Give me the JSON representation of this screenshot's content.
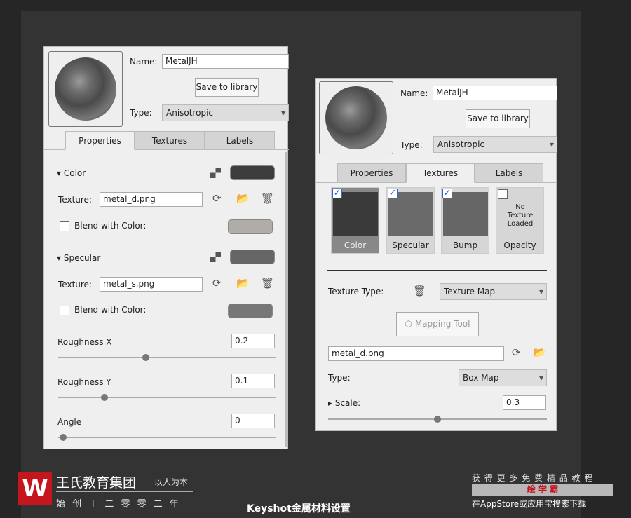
{
  "left_panel": {
    "name_label": "Name:",
    "name_value": "MetalJH",
    "save_label": "Save to library",
    "type_label": "Type:",
    "type_value": "Anisotropic",
    "tabs": [
      "Properties",
      "Textures",
      "Labels"
    ],
    "active_tab": "Properties",
    "color": {
      "heading": "Color",
      "texture_label": "Texture:",
      "texture_value": "metal_d.png",
      "blend_label": "Blend with Color:",
      "swatch": "#3c3c3c",
      "blend_swatch": "#b0aca8"
    },
    "specular": {
      "heading": "Specular",
      "texture_label": "Texture:",
      "texture_value": "metal_s.png",
      "blend_label": "Blend with Color:",
      "swatch": "#666666",
      "blend_swatch": "#777777"
    },
    "roughness_x": {
      "label": "Roughness X",
      "value": "0.2"
    },
    "roughness_y": {
      "label": "Roughness Y",
      "value": "0.1"
    },
    "angle": {
      "label": "Angle",
      "value": "0"
    }
  },
  "right_panel": {
    "name_label": "Name:",
    "name_value": "MetalJH",
    "save_label": "Save to library",
    "type_label": "Type:",
    "type_value": "Anisotropic",
    "tabs": [
      "Properties",
      "Textures",
      "Labels"
    ],
    "active_tab": "Textures",
    "textures": [
      {
        "label": "Color",
        "checked": true
      },
      {
        "label": "Specular",
        "checked": true
      },
      {
        "label": "Bump",
        "checked": true
      },
      {
        "label": "Opacity",
        "checked": false,
        "empty_text": "No Texture Loaded"
      }
    ],
    "texture_type_label": "Texture Type:",
    "texture_type_value": "Texture Map",
    "mapping_tool_label": "Mapping Tool",
    "file_value": "metal_d.png",
    "map_type_label": "Type:",
    "map_type_value": "Box Map",
    "scale_label": "Scale:",
    "scale_value": "0.3"
  },
  "footer": {
    "brand": "王氏教育集团",
    "slogan": "以人为本",
    "founded": "始 创 于 二 零 零 二 年",
    "caption": "Keyshot金属材料设置",
    "promo_top": "获 得 更 多 免 费 精 品 教 程",
    "promo_app": "绘 学 霸",
    "promo_bottom": "在AppStore或应用宝搜索下载"
  }
}
